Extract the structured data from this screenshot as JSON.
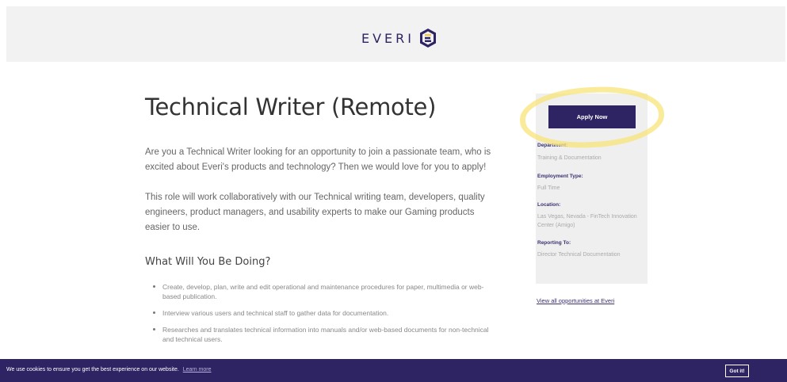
{
  "header": {
    "logo_text": "EVERI",
    "brand_color": "#2e2463"
  },
  "job": {
    "title": "Technical Writer (Remote)",
    "intro_1": "Are you a Technical Writer looking for an opportunity to join a passionate team, who is excited about Everi's products and technology? Then we would love for you to apply!",
    "intro_2": "This role will work collaboratively with our Technical writing team, developers, quality engineers, product managers, and usability experts to make our Gaming products easier to use.",
    "section_title": "What Will You Be Doing?",
    "bullets": [
      "Create, develop, plan, write and edit operational and maintenance procedures for paper, multimedia or web-based publication.",
      "Interview various users and technical staff to gather data for documentation.",
      "Researches and translates technical information into manuals and/or web-based documents for non-technical and technical users."
    ]
  },
  "sidebar": {
    "apply_label": "Apply Now",
    "highlight_color": "#f8e478",
    "department_label": "Department:",
    "department_value": "Training & Documentation",
    "employment_label": "Employment Type:",
    "employment_value": "Full Time",
    "location_label": "Location:",
    "location_value": "Las Vegas, Nevada - FinTech Innovation Center (Amigo)",
    "reporting_label": "Reporting To:",
    "reporting_value": "Director Technical Documentation",
    "all_opportunities_link": "View all opportunities at Everi"
  },
  "cookie": {
    "message": "We use cookies to ensure you get the best experience on our website.",
    "learn_more": "Learn more",
    "got_it": "Got it!"
  }
}
